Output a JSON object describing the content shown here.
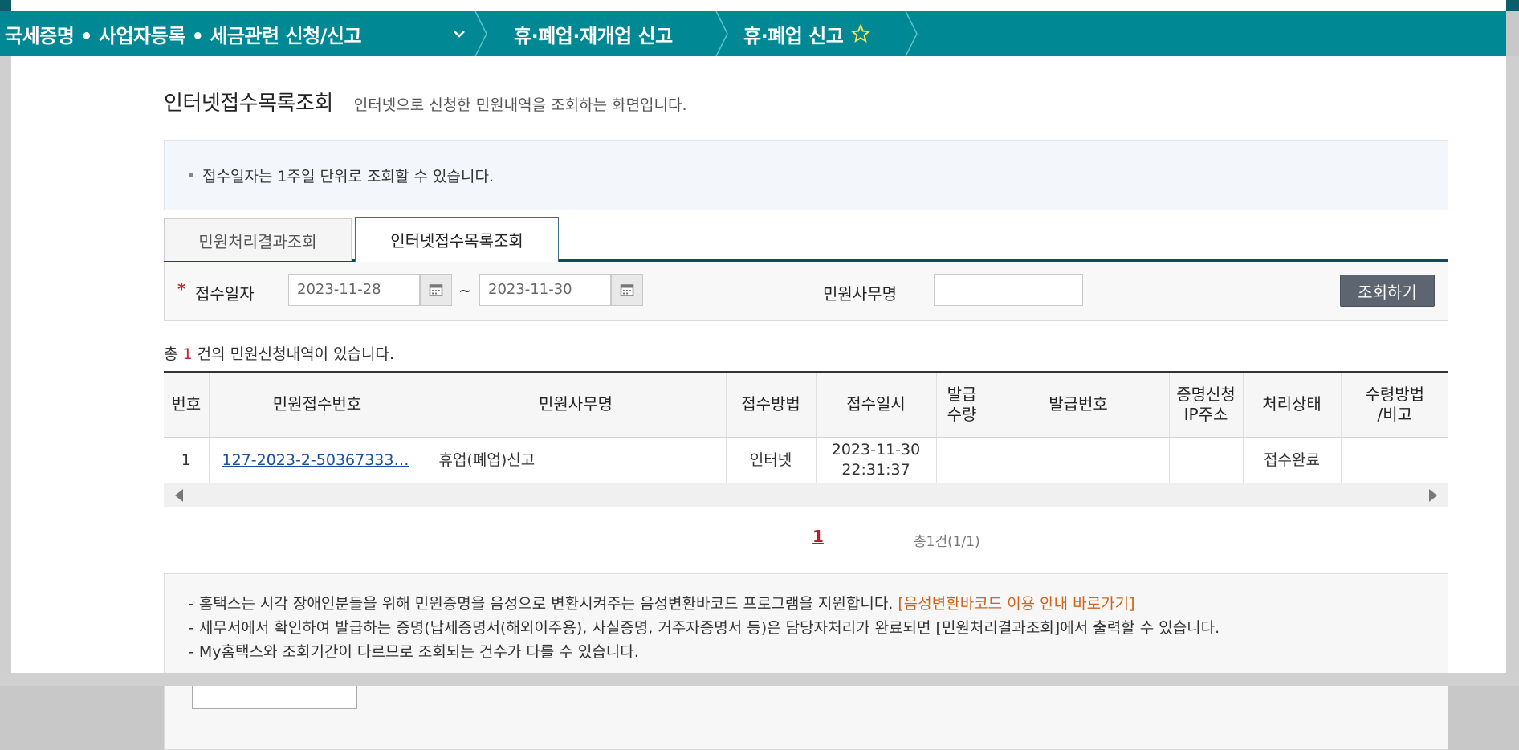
{
  "nav": {
    "crumb1": "국세증명 • 사업자등록 • 세금관련 신청/신고",
    "crumb2": "휴·폐업·재개업 신고",
    "crumb3": "휴·폐업 신고"
  },
  "page": {
    "title": "인터넷접수목록조회",
    "description": "인터넷으로 신청한 민원내역을 조회하는 화면입니다."
  },
  "notice": "접수일자는 1주일 단위로 조회할 수 있습니다.",
  "tabs": [
    {
      "label": "민원처리결과조회"
    },
    {
      "label": "인터넷접수목록조회"
    }
  ],
  "search": {
    "date_label": "접수일자",
    "date_from": "2023-11-28",
    "date_to": "2023-11-30",
    "tilde": "~",
    "name_label": "민원사무명",
    "name_value": "",
    "button": "조회하기"
  },
  "result": {
    "prefix": "총",
    "count": "1",
    "suffix": "건의 민원신청내역이 있습니다."
  },
  "table": {
    "headers": [
      "번호",
      "민원접수번호",
      "민원사무명",
      "접수방법",
      "접수일시",
      "발급\n수량",
      "발급번호",
      "증명신청\nIP주소",
      "처리상태",
      "수령방법\n/비고"
    ],
    "rows": [
      {
        "no": "1",
        "receipt_no": "127-2023-2-50367333…",
        "name": "휴업(폐업)신고",
        "method": "인터넷",
        "date": "2023-11-30",
        "time": "22:31:37",
        "qty": "",
        "issue_no": "",
        "ip": "",
        "status": "접수완료",
        "remarks": ""
      }
    ]
  },
  "pager": {
    "current": "1",
    "total": "총1건(1/1)"
  },
  "info": {
    "line1": "- 홈택스는 시각 장애인분들을 위해 민원증명을 음성으로 변환시켜주는 음성변환바코드 프로그램을 지원합니다.",
    "line1_link": "[음성변환바코드 이용 안내 바로가기]",
    "line2": "- 세무서에서 확인하여 발급하는 증명(납세증명서(해외이주용), 사실증명, 거주자증명서 등)은 담당자처리가 완료되면 [민원처리결과조회]에서 출력할 수 있습니다.",
    "line3": "- My홈택스와 조회기간이 다르므로 조회되는 건수가 다를 수 있습니다."
  },
  "colors": {
    "nav_bg": "#008895",
    "tab_border": "#0b4c5e",
    "button_bg": "#5d6570",
    "accent_red": "#c0272d",
    "link_orange": "#d0631b"
  }
}
